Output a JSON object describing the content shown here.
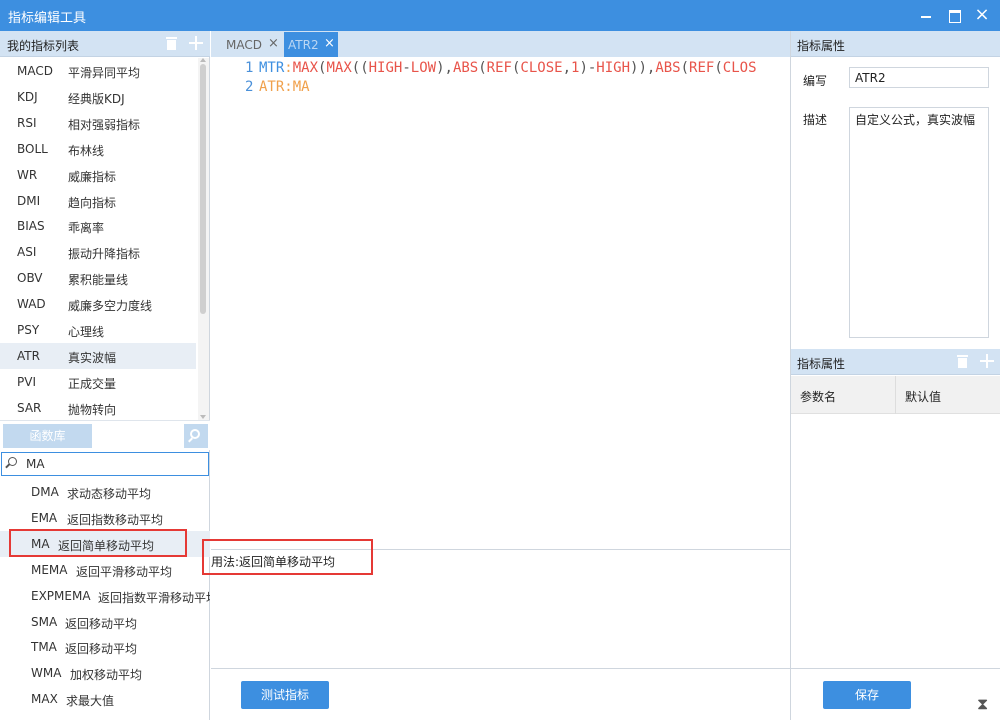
{
  "window": {
    "title": "指标编辑工具",
    "close_glyph": "×"
  },
  "left_panel": {
    "header": "我的指标列表",
    "indicators": [
      {
        "code": "MACD",
        "name": "平滑异同平均"
      },
      {
        "code": "KDJ",
        "name": "经典版KDJ"
      },
      {
        "code": "RSI",
        "name": "相对强弱指标"
      },
      {
        "code": "BOLL",
        "name": "布林线"
      },
      {
        "code": "WR",
        "name": "威廉指标"
      },
      {
        "code": "DMI",
        "name": "趋向指标"
      },
      {
        "code": "BIAS",
        "name": "乖离率"
      },
      {
        "code": "ASI",
        "name": "振动升降指标"
      },
      {
        "code": "OBV",
        "name": "累积能量线"
      },
      {
        "code": "WAD",
        "name": "威廉多空力度线"
      },
      {
        "code": "PSY",
        "name": "心理线"
      },
      {
        "code": "ATR",
        "name": "真实波幅"
      },
      {
        "code": "PVI",
        "name": "正成交量"
      },
      {
        "code": "SAR",
        "name": "抛物转向"
      }
    ],
    "selected_indicator": "ATR",
    "func_lib_tab": "函数库",
    "search_value": "MA",
    "functions": [
      {
        "code": "DMA",
        "desc": "求动态移动平均"
      },
      {
        "code": "EMA",
        "desc": "返回指数移动平均"
      },
      {
        "code": "MA",
        "desc": "返回简单移动平均"
      },
      {
        "code": "MEMA",
        "desc": "返回平滑移动平均"
      },
      {
        "code": "EXPMEMA",
        "desc": "返回指数平滑移动平均"
      },
      {
        "code": "SMA",
        "desc": "返回移动平均"
      },
      {
        "code": "TMA",
        "desc": "返回移动平均"
      },
      {
        "code": "WMA",
        "desc": "加权移动平均"
      },
      {
        "code": "MAX",
        "desc": "求最大值"
      }
    ],
    "selected_function": "MA"
  },
  "editor": {
    "tabs": [
      {
        "label": "MACD",
        "active": false
      },
      {
        "label": "ATR2",
        "active": true
      }
    ],
    "tab_close_glyph": "×",
    "lines": [
      {
        "number": "1",
        "tokens": [
          {
            "text": "MTR",
            "cls": "kw"
          },
          {
            "text": ":",
            "cls": "orange"
          },
          {
            "text": "MAX",
            "cls": "fn"
          },
          {
            "text": "(",
            "cls": "plain"
          },
          {
            "text": "MAX",
            "cls": "fn"
          },
          {
            "text": "((",
            "cls": "plain"
          },
          {
            "text": "HIGH",
            "cls": "fn"
          },
          {
            "text": "-",
            "cls": "plain"
          },
          {
            "text": "LOW",
            "cls": "fn"
          },
          {
            "text": "),",
            "cls": "plain"
          },
          {
            "text": "ABS",
            "cls": "fn"
          },
          {
            "text": "(",
            "cls": "plain"
          },
          {
            "text": "REF",
            "cls": "fn"
          },
          {
            "text": "(",
            "cls": "plain"
          },
          {
            "text": "CLOSE",
            "cls": "fn"
          },
          {
            "text": ",",
            "cls": "plain"
          },
          {
            "text": "1",
            "cls": "num"
          },
          {
            "text": ")-",
            "cls": "plain"
          },
          {
            "text": "HIGH",
            "cls": "fn"
          },
          {
            "text": ")),",
            "cls": "plain"
          },
          {
            "text": "ABS",
            "cls": "fn"
          },
          {
            "text": "(",
            "cls": "plain"
          },
          {
            "text": "REF",
            "cls": "fn"
          },
          {
            "text": "(",
            "cls": "plain"
          },
          {
            "text": "CLOS",
            "cls": "fn"
          }
        ]
      },
      {
        "number": "2",
        "tokens": [
          {
            "text": "ATR",
            "cls": "orange"
          },
          {
            "text": ":",
            "cls": "orange"
          },
          {
            "text": "MA",
            "cls": "orange"
          }
        ]
      }
    ],
    "usage_text": "用法:返回简单移动平均",
    "test_button": "测试指标"
  },
  "right_panel": {
    "header": "指标属性",
    "code_label": "编写",
    "code_value": "ATR2",
    "desc_label": "描述",
    "desc_value": "自定义公式，真实波幅",
    "param_header": "指标属性",
    "param_col_name": "参数名",
    "param_col_default": "默认值",
    "save_button": "保存"
  },
  "colors": {
    "title_bar": "#3d8fe0",
    "panel_header": "#d3e3f3",
    "highlight_red": "#e53935",
    "button_blue": "#3d8fe0"
  }
}
